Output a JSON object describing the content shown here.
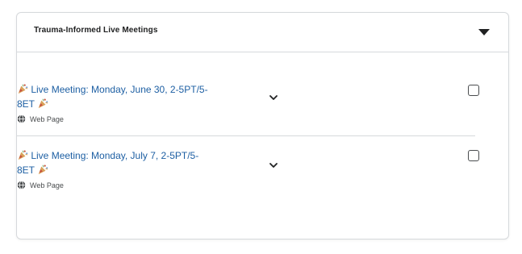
{
  "module": {
    "title": "Trauma-Informed Live Meetings",
    "collapse_icon": "caret-down-icon"
  },
  "items": [
    {
      "title": "Live Meeting: Monday, June 30, 2-5PT/5-8ET",
      "type_label": "Web Page",
      "type_icon": "globe-icon",
      "decor_icon": "party-popper-icon",
      "expand_icon": "chevron-down-icon",
      "checked": false
    },
    {
      "title": "Live Meeting: Monday, July 7, 2-5PT/5-8ET",
      "type_label": "Web Page",
      "type_icon": "globe-icon",
      "decor_icon": "party-popper-icon",
      "expand_icon": "chevron-down-icon",
      "checked": false
    }
  ],
  "colors": {
    "link": "#1d5fa3",
    "border": "#d6d9dc",
    "text": "#202122"
  }
}
